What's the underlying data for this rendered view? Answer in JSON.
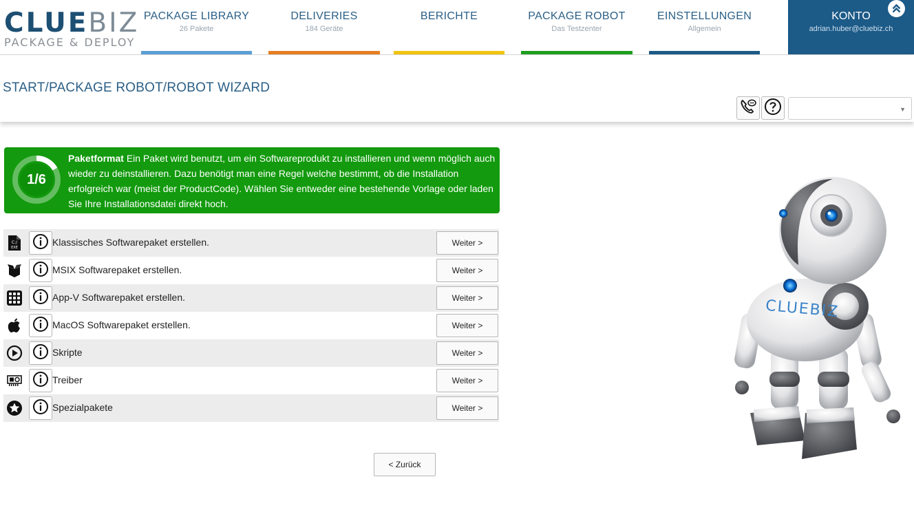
{
  "brand": {
    "word_a": "CLUE",
    "word_b": "BIZ",
    "tagline": "PACKAGE & DEPLOY"
  },
  "nav": [
    {
      "label": "PACKAGE LIBRARY",
      "sub": "26 Pakete",
      "color": "#5b9fd6"
    },
    {
      "label": "DELIVERIES",
      "sub": "184 Geräte",
      "color": "#e67e22"
    },
    {
      "label": "BERICHTE",
      "sub": "",
      "color": "#f1c40f"
    },
    {
      "label": "PACKAGE ROBOT",
      "sub": "Das Testzenter",
      "color": "#1e9e1e"
    },
    {
      "label": "EINSTELLUNGEN",
      "sub": "Allgemein",
      "color": "#1c5a87"
    }
  ],
  "account": {
    "label": "KONTO",
    "email": "adrian.huber@cluebiz.ch",
    "collapse_icon": "double-chevron-up-icon"
  },
  "breadcrumb": "START/PACKAGE ROBOT/ROBOT WIZARD",
  "toolbar": {
    "phone_icon": "phone-chat-icon",
    "help_icon": "question-circle-icon",
    "select_value": ""
  },
  "step": {
    "progress": "1/6",
    "fraction": 0.1667,
    "title": "Paketformat",
    "text": "Ein Paket wird benutzt, um ein Softwareprodukt zu installieren und wenn möglich auch wieder zu deinstallieren. Dazu benötigt man eine Regel welche bestimmt, ob die Installation erfolgreich war (meist der ProductCode). Wählen Sie entweder eine bestehende Vorlage oder laden Sie Ihre Installationsdatei direkt hoch.",
    "color": "#139a0e"
  },
  "options": [
    {
      "icon": "exe-file-icon",
      "label": "Klassisches Softwarepaket erstellen.",
      "button": "Weiter >"
    },
    {
      "icon": "open-box-icon",
      "label": "MSIX Softwarepaket erstellen.",
      "button": "Weiter >"
    },
    {
      "icon": "app-grid-icon",
      "label": "App-V Softwarepaket erstellen.",
      "button": "Weiter >"
    },
    {
      "icon": "apple-icon",
      "label": "MacOS Softwarepaket erstellen.",
      "button": "Weiter >"
    },
    {
      "icon": "play-circle-icon",
      "label": "Skripte",
      "button": "Weiter >"
    },
    {
      "icon": "hardware-card-icon",
      "label": "Treiber",
      "button": "Weiter >"
    },
    {
      "icon": "star-circle-icon",
      "label": "Spezialpakete",
      "button": "Weiter >"
    }
  ],
  "back_button": "< Zurück",
  "robot": {
    "chest_text": "CLUEBIZ"
  }
}
